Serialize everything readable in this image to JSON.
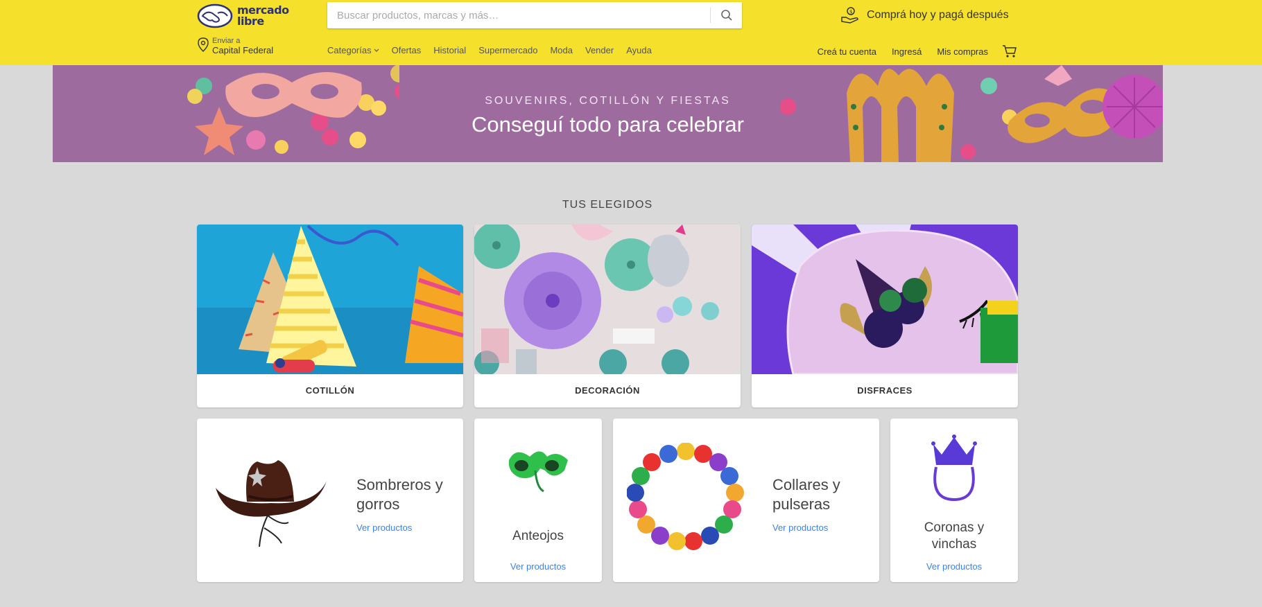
{
  "header": {
    "logo_line1": "mercado",
    "logo_line2": "libre",
    "search_placeholder": "Buscar productos, marcas y más…",
    "promo": "Comprá hoy y pagá después",
    "ship_label": "Enviar a",
    "ship_location": "Capital Federal",
    "nav": [
      "Categorías",
      "Ofertas",
      "Historial",
      "Supermercado",
      "Moda",
      "Vender",
      "Ayuda"
    ],
    "account": [
      "Creá tu cuenta",
      "Ingresá",
      "Mis compras"
    ],
    "colors": {
      "brand_yellow": "#f5e02c",
      "brand_blue": "#2d3277"
    }
  },
  "banner": {
    "overline": "SOUVENIRS, COTILLÓN Y FIESTAS",
    "title": "Conseguí todo para celebrar",
    "background": "#9e6b9e"
  },
  "section": {
    "title": "TUS ELEGIDOS",
    "categories": [
      {
        "label": "COTILLÓN"
      },
      {
        "label": "DECORACIÓN"
      },
      {
        "label": "DISFRACES"
      }
    ],
    "products": [
      {
        "name_line1": "Sombreros y",
        "name_line2": "gorros",
        "link": "Ver productos"
      },
      {
        "name_line1": "Anteojos",
        "link": "Ver productos"
      },
      {
        "name_line1": "Collares y",
        "name_line2": "pulseras",
        "link": "Ver productos"
      },
      {
        "name_line1": "Coronas y",
        "name_line2": "vinchas",
        "link": "Ver productos"
      }
    ],
    "link_color": "#3483fa"
  }
}
